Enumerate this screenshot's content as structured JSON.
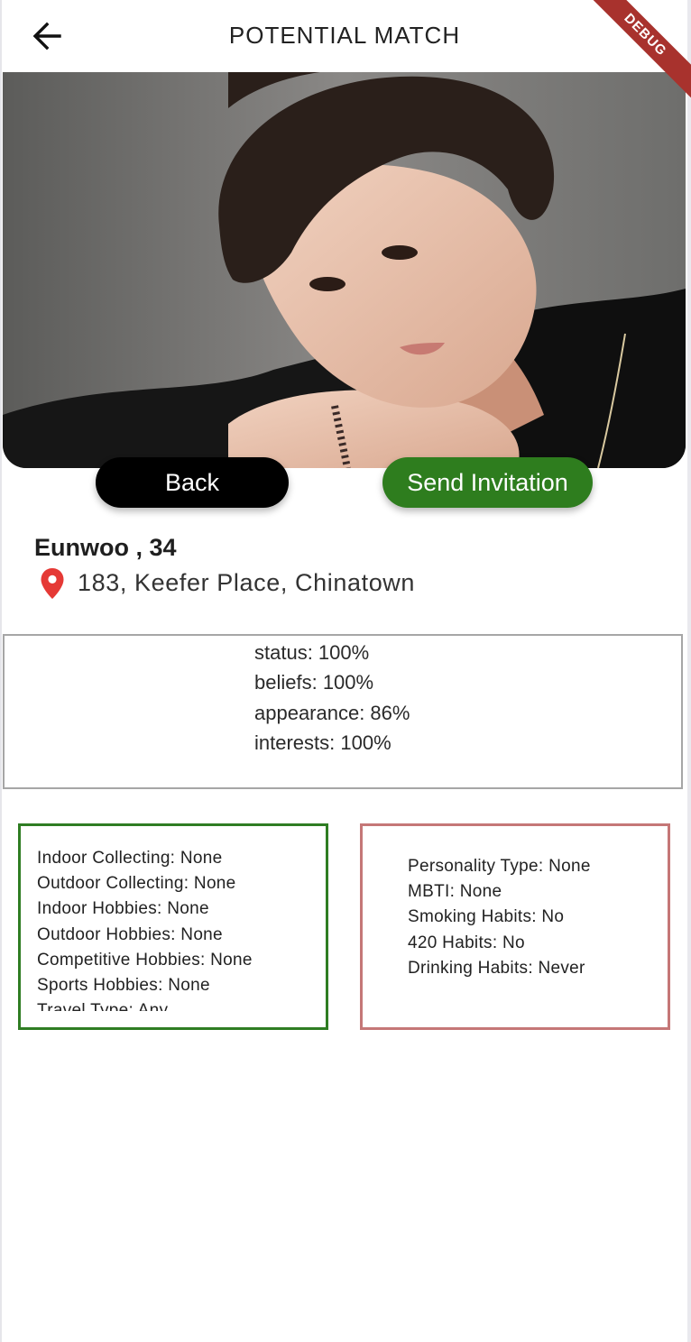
{
  "appbar": {
    "title": "POTENTIAL MATCH",
    "debug_label": "DEBUG"
  },
  "actions": {
    "back_label": "Back",
    "invite_label": "Send Invitation"
  },
  "profile": {
    "name_age": "Eunwoo , 34",
    "address": "183,  Keefer Place,  Chinatown"
  },
  "scores": [
    "status: 100%",
    "beliefs: 100%",
    "appearance: 86%",
    "interests: 100%"
  ],
  "hobbies": [
    "Indoor Collecting: None",
    "Outdoor Collecting: None",
    "Indoor Hobbies: None",
    "Outdoor Hobbies: None",
    "Competitive Hobbies: None",
    "Sports Hobbies: None",
    "Travel Type: Any"
  ],
  "habits": [
    "Personality Type: None",
    "MBTI: None",
    "Smoking Habits: No",
    "420 Habits: No",
    "Drinking Habits: Never"
  ],
  "colors": {
    "invite_button": "#2e7d1e",
    "back_button": "#000000",
    "hobbies_border": "#2f7d23",
    "habits_border": "#c57777",
    "pin": "#e53935",
    "debug_banner": "#a8322d"
  },
  "icons": {
    "back": "arrow-left-icon",
    "location": "location-pin-icon"
  }
}
